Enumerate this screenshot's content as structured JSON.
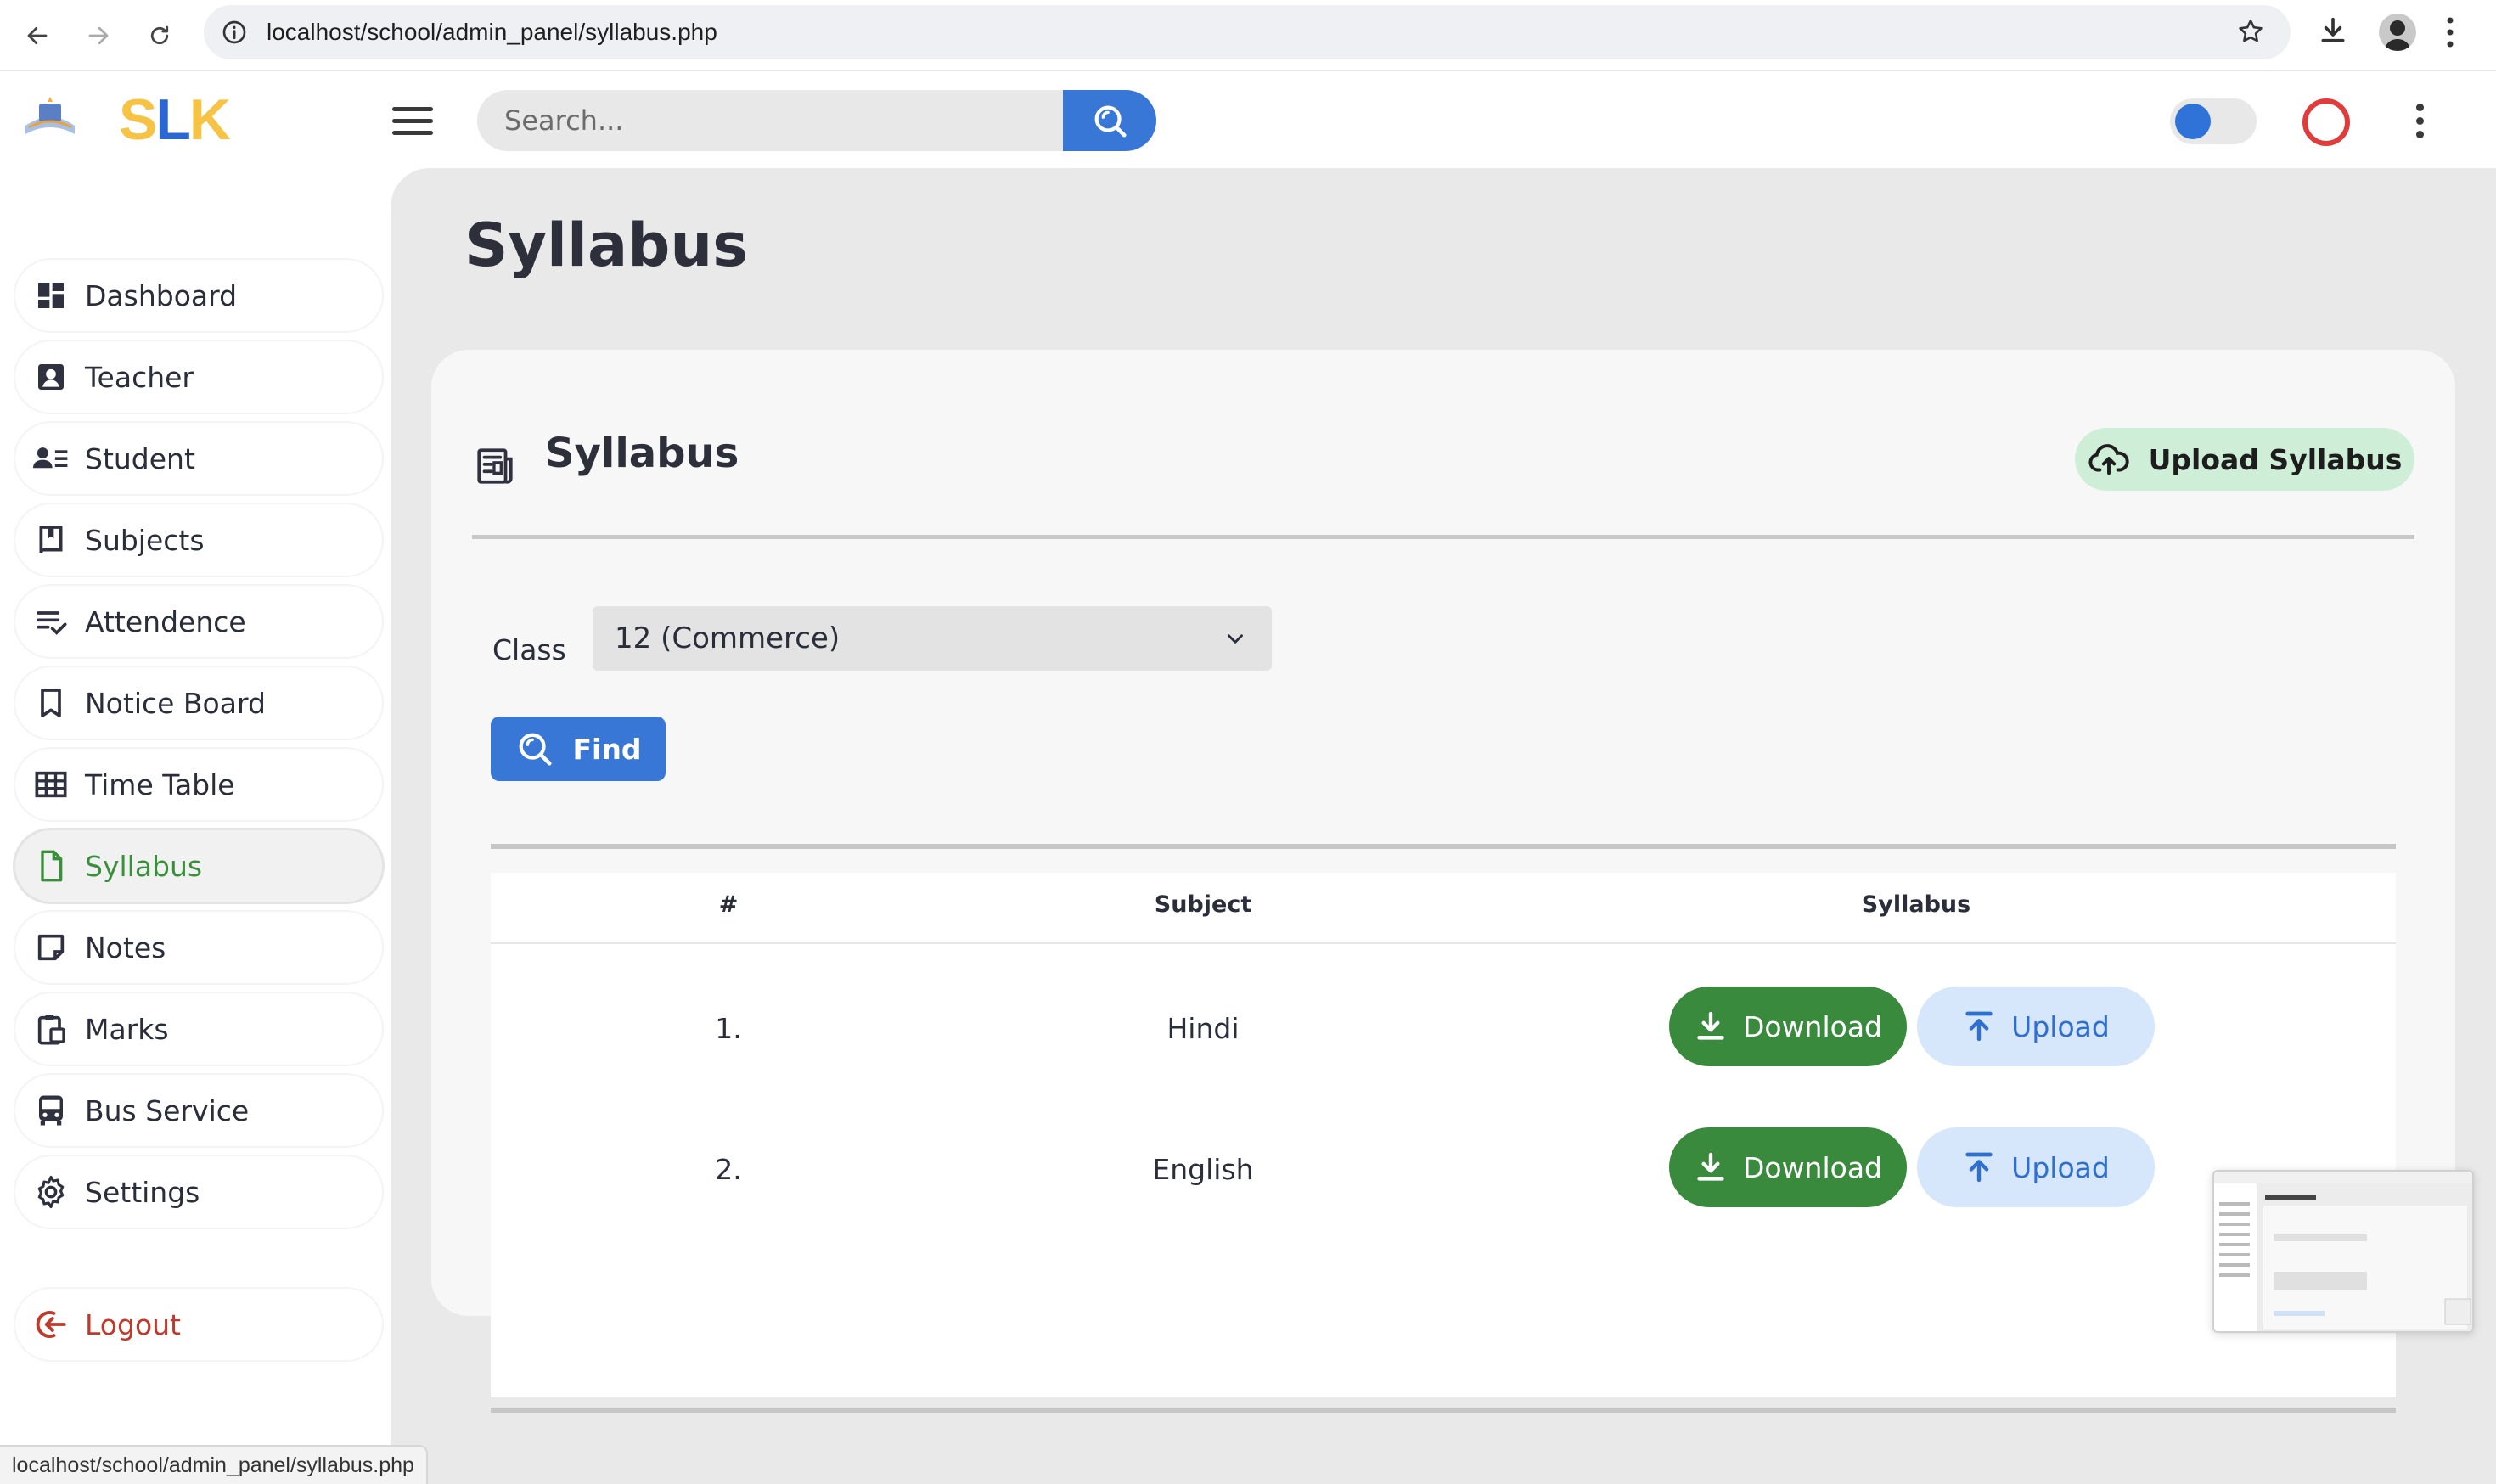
{
  "browser": {
    "url": "localhost/school/admin_panel/syllabus.php"
  },
  "brand": {
    "s": "S",
    "l": "L",
    "k": "K"
  },
  "search": {
    "placeholder": "Search..."
  },
  "sidebar": {
    "items": [
      {
        "label": "Dashboard",
        "icon": "dashboard-icon"
      },
      {
        "label": "Teacher",
        "icon": "teacher-icon"
      },
      {
        "label": "Student",
        "icon": "student-icon"
      },
      {
        "label": "Subjects",
        "icon": "subjects-icon"
      },
      {
        "label": "Attendence",
        "icon": "attendance-icon"
      },
      {
        "label": "Notice Board",
        "icon": "bookmark-icon"
      },
      {
        "label": "Time Table",
        "icon": "table-icon"
      },
      {
        "label": "Syllabus",
        "icon": "document-icon",
        "active": true
      },
      {
        "label": "Notes",
        "icon": "note-icon"
      },
      {
        "label": "Marks",
        "icon": "clipboard-icon"
      },
      {
        "label": "Bus Service",
        "icon": "bus-icon"
      },
      {
        "label": "Settings",
        "icon": "gear-icon"
      }
    ],
    "logout": "Logout"
  },
  "page": {
    "title": "Syllabus",
    "card_title": "Syllabus",
    "upload_syllabus": "Upload Syllabus",
    "class_label": "Class",
    "class_value": "12 (Commerce)",
    "find": "Find"
  },
  "table": {
    "headers": [
      "#",
      "Subject",
      "Syllabus"
    ],
    "rows": [
      {
        "num": "1.",
        "subject": "Hindi",
        "download": "Download",
        "upload": "Upload"
      },
      {
        "num": "2.",
        "subject": "English",
        "download": "Download",
        "upload": "Upload"
      }
    ]
  },
  "status_bar_url": "localhost/school/admin_panel/syllabus.php",
  "colors": {
    "primary": "#3877d6",
    "download": "#3a8a3e",
    "upload_bg": "#d6e6fb",
    "active_text": "#3a8f3a",
    "logout": "#c0392b",
    "brand_yellow": "#f6c344"
  }
}
